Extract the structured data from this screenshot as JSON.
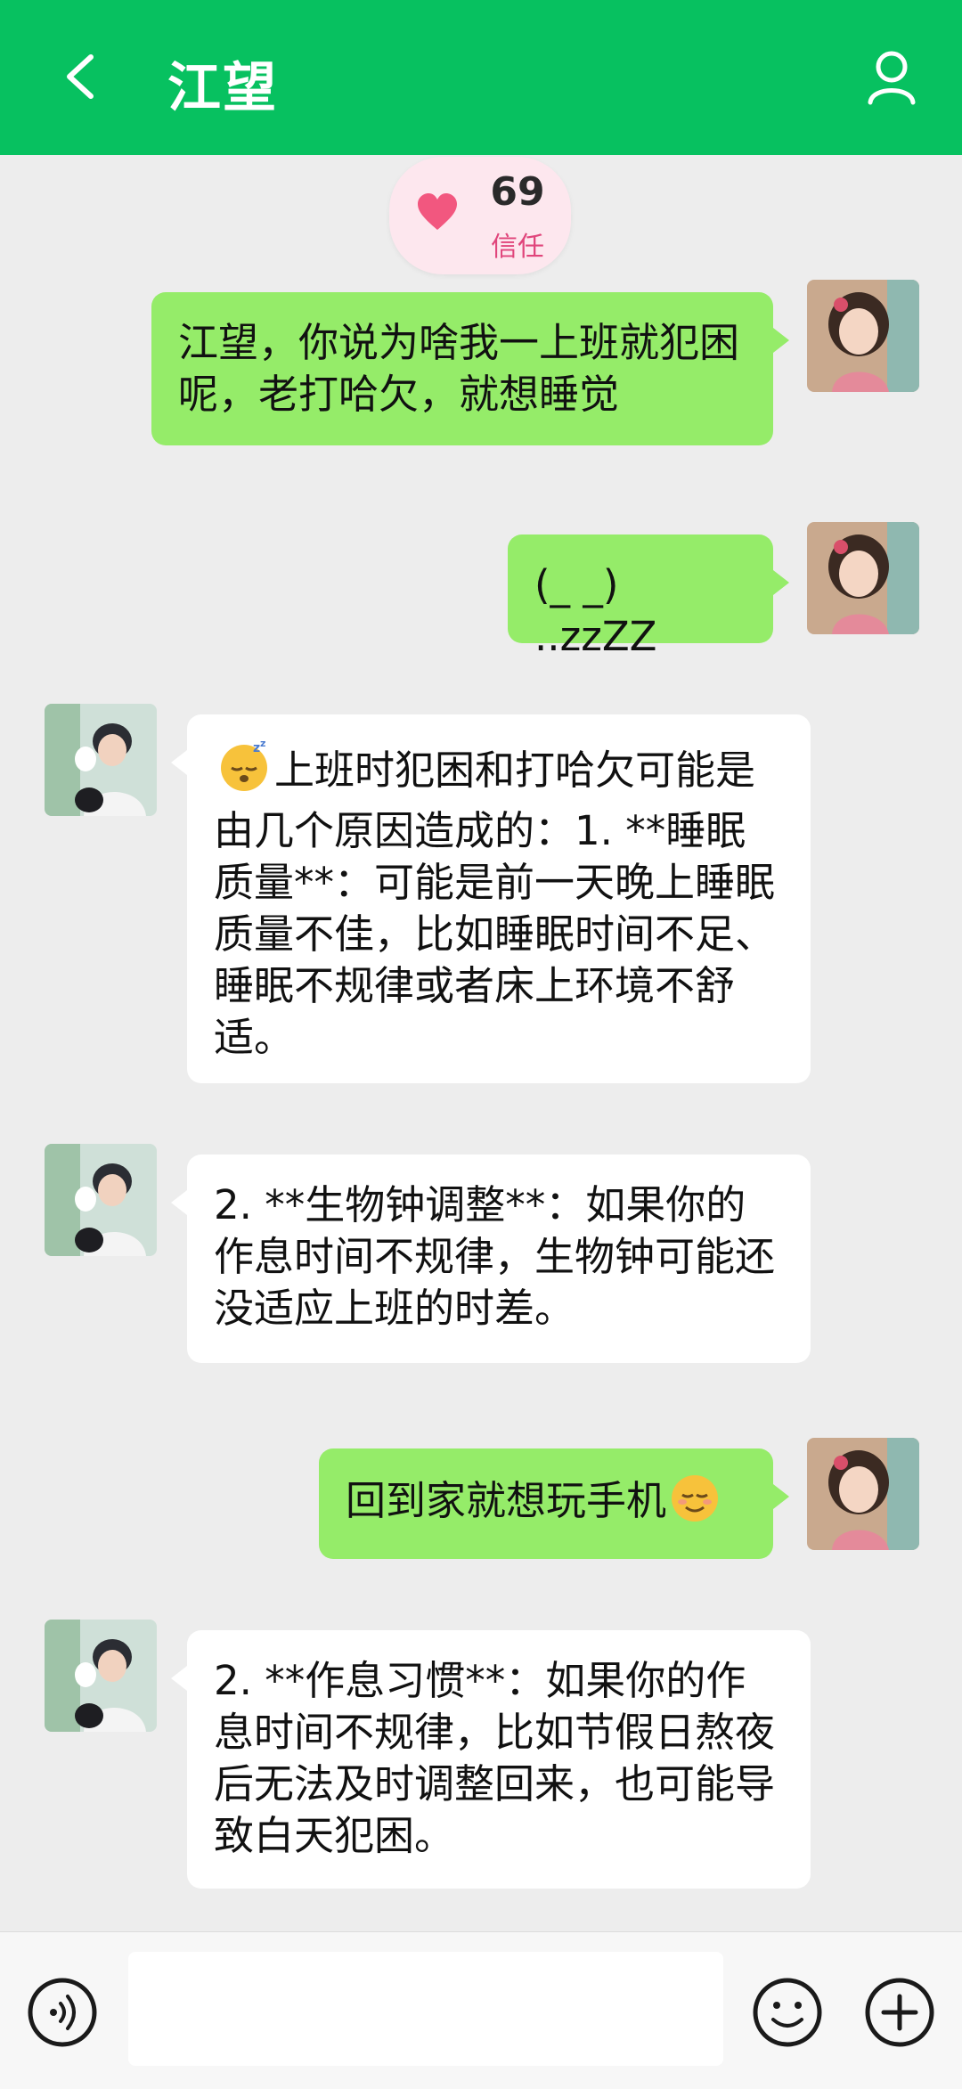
{
  "header": {
    "title": "江望",
    "bg_color": "#07c160"
  },
  "trust": {
    "value": "69",
    "label": "信任",
    "icon": "heart-icon"
  },
  "messages": [
    {
      "from": "user",
      "text": "江望，你说为啥我一上班就犯困呢，老打哈欠，就想睡觉"
    },
    {
      "from": "user",
      "text": "(_ _) ..zzZZ"
    },
    {
      "from": "bot",
      "emoji": "sleepy-zzz-emoji",
      "text": "上班时犯困和打哈欠可能是由几个原因造成的：1. **睡眠质量**：可能是前一天晚上睡眠质量不佳，比如睡眠时间不足、睡眠不规律或者床上环境不舒适。"
    },
    {
      "from": "bot",
      "text": "2. **生物钟调整**：如果你的作息时间不规律，生物钟可能还没适应上班的时差。"
    },
    {
      "from": "user",
      "text": "回到家就想玩手机",
      "emoji": "relieved-face-emoji"
    },
    {
      "from": "bot",
      "text": "2. **作息习惯**：如果你的作息时间不规律，比如节假日熬夜后无法及时调整回来，也可能导致白天犯困。"
    }
  ],
  "input": {
    "placeholder": "",
    "voice_icon": "voice-icon",
    "emoji_icon": "emoji-icon",
    "plus_icon": "plus-icon"
  },
  "colors": {
    "user_bubble": "#95ec69",
    "bot_bubble": "#ffffff",
    "background": "#ededed"
  }
}
